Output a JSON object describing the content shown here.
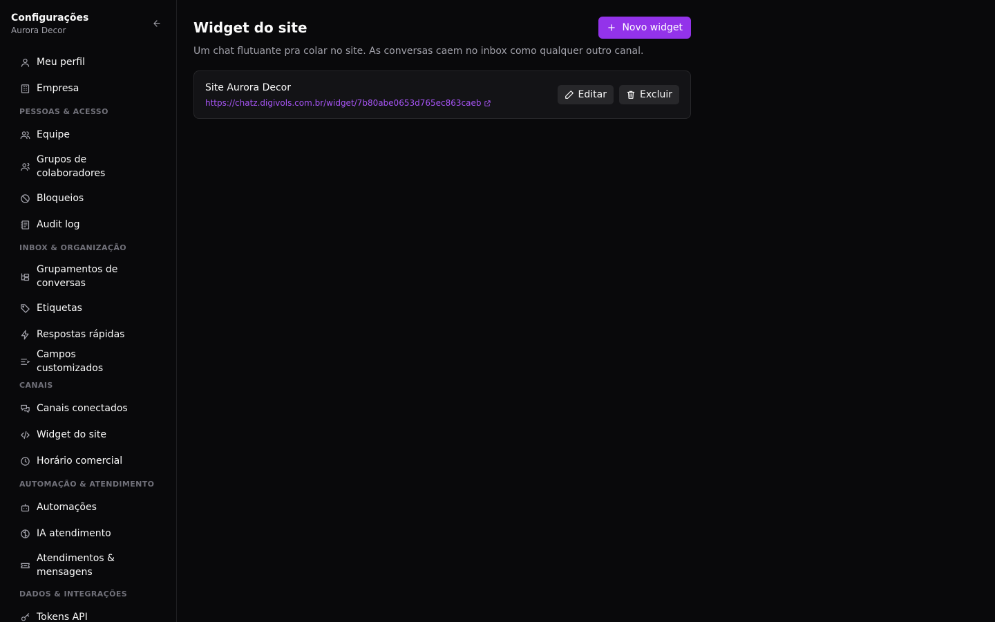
{
  "sidebar": {
    "title": "Configurações",
    "subtitle": "Aurora Decor",
    "collapse_icon": "arrow-left-icon",
    "top_items": [
      {
        "label": "Meu perfil",
        "icon": "user-icon"
      },
      {
        "label": "Empresa",
        "icon": "building-icon"
      }
    ],
    "sections": [
      {
        "label": "PESSOAS & ACESSO",
        "items": [
          {
            "label": "Equipe",
            "icon": "users-icon"
          },
          {
            "label": "Grupos de colaboradores",
            "icon": "user-group-icon"
          },
          {
            "label": "Bloqueios",
            "icon": "ban-icon"
          },
          {
            "label": "Audit log",
            "icon": "log-icon"
          }
        ]
      },
      {
        "label": "INBOX & ORGANIZAÇÃO",
        "items": [
          {
            "label": "Grupamentos de conversas",
            "icon": "folders-icon"
          },
          {
            "label": "Etiquetas",
            "icon": "tag-icon"
          },
          {
            "label": "Respostas rápidas",
            "icon": "zap-icon"
          },
          {
            "label": "Campos customizados",
            "icon": "list-fields-icon"
          }
        ]
      },
      {
        "label": "CANAIS",
        "items": [
          {
            "label": "Canais conectados",
            "icon": "chat-bubbles-icon"
          },
          {
            "label": "Widget do site",
            "icon": "code-icon"
          },
          {
            "label": "Horário comercial",
            "icon": "clock-icon"
          }
        ]
      },
      {
        "label": "AUTOMAÇÃO & ATENDIMENTO",
        "items": [
          {
            "label": "Automações",
            "icon": "bot-icon"
          },
          {
            "label": "IA atendimento",
            "icon": "brain-icon"
          },
          {
            "label": "Atendimentos & mensagens",
            "icon": "ticket-icon"
          }
        ]
      },
      {
        "label": "DADOS & INTEGRAÇÕES",
        "items": [
          {
            "label": "Tokens API",
            "icon": "key-icon"
          }
        ]
      }
    ]
  },
  "main": {
    "title": "Widget do site",
    "new_button": "Novo widget",
    "description": "Um chat flutuante pra colar no site. As conversas caem no inbox como qualquer outro canal.",
    "widgets": [
      {
        "name": "Site Aurora Decor",
        "url": "https://chatz.digivols.com.br/widget/7b80abe0653d765ec863caeb",
        "edit_label": "Editar",
        "delete_label": "Excluir"
      }
    ]
  },
  "colors": {
    "accent": "#9333ea",
    "link": "#a855f7",
    "background": "#09090b",
    "card": "#131316"
  }
}
